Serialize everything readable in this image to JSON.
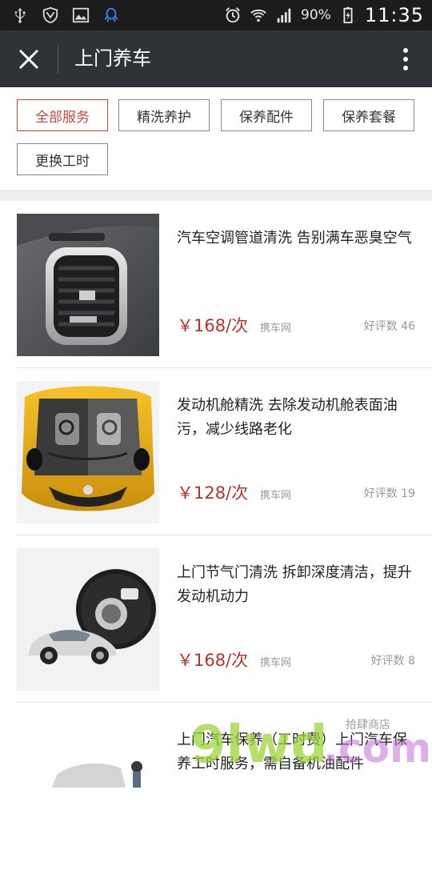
{
  "status_bar": {
    "battery_percent": "90%",
    "time": "11:35",
    "icons": [
      "usb-icon",
      "shield-icon",
      "gallery-icon",
      "qq-icon",
      "alarm-icon",
      "wifi-icon",
      "signal-icon",
      "battery-charging-icon"
    ]
  },
  "title_bar": {
    "title": "上门养车",
    "close_icon": "close-icon",
    "more_icon": "more-vertical-icon"
  },
  "filters": {
    "chips": [
      {
        "label": "全部服务",
        "active": true
      },
      {
        "label": "精洗养护",
        "active": false
      },
      {
        "label": "保养配件",
        "active": false
      },
      {
        "label": "保养套餐",
        "active": false
      },
      {
        "label": "更换工时",
        "active": false
      }
    ]
  },
  "services": [
    {
      "name": "汽车空调管道清洗 告别满车恶臭空气",
      "price": "￥168/次",
      "source": "携车网",
      "reviews": "好评数 46"
    },
    {
      "name": "发动机舱精洗 去除发动机舱表面油污，减少线路老化",
      "price": "￥128/次",
      "source": "携车网",
      "reviews": "好评数 19"
    },
    {
      "name": "上门节气门清洗 拆卸深度清洁，提升发动机动力",
      "price": "￥168/次",
      "source": "携车网",
      "reviews": "好评数 8"
    },
    {
      "name": "上门汽车保养（工时费）上门汽车保养工时服务，需自备机油配件",
      "price": "",
      "source": "",
      "reviews": ""
    }
  ],
  "watermark": {
    "text": "9lwd.com",
    "subtext": "拾肆商店"
  },
  "colors": {
    "accent": "#b8312f",
    "title_bar": "#2f3237",
    "status_bar": "#1c1c1c"
  }
}
